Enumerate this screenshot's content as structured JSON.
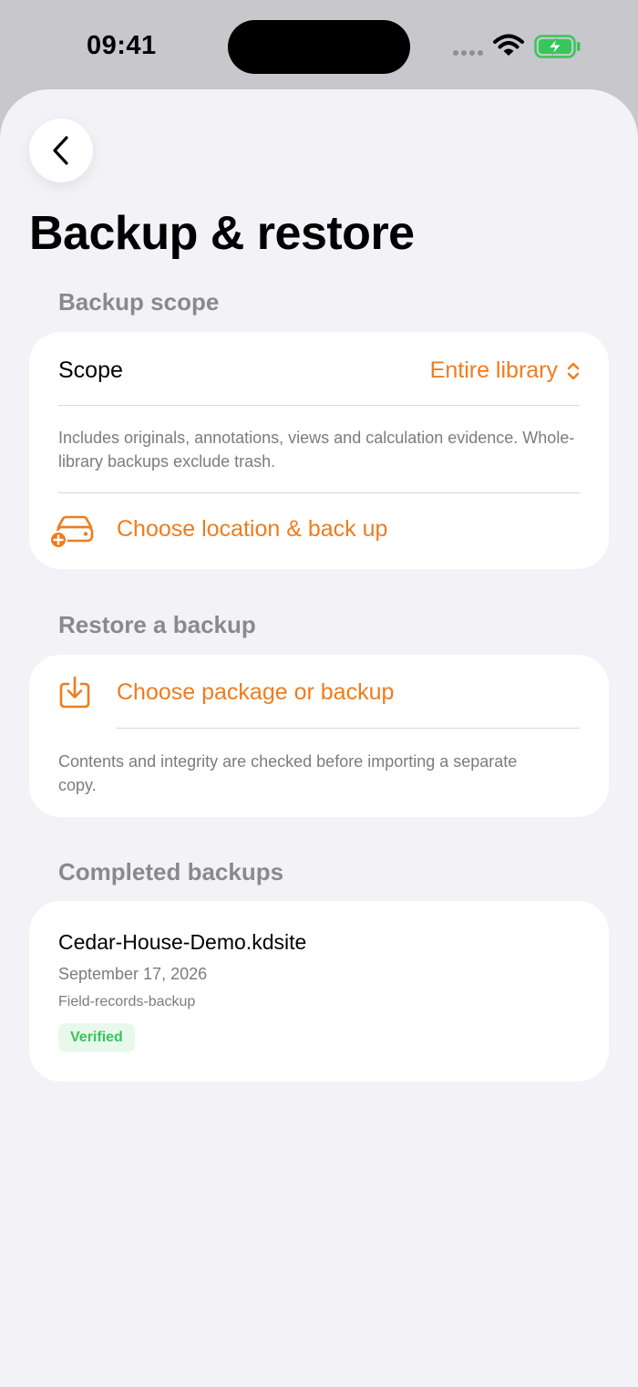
{
  "status_bar": {
    "time": "09:41",
    "icons": [
      "signal-icon",
      "wifi-icon",
      "battery-charging-icon"
    ]
  },
  "header": {
    "back_icon": "chevron-left-icon",
    "title": "Backup & restore"
  },
  "backup_scope": {
    "header": "Backup scope",
    "scope_label": "Scope",
    "scope_value": "Entire library",
    "scope_value_icon": "chevron-up-down-icon",
    "description": "Includes originals, annotations, views and calculation evidence. Whole-library backups exclude trash.",
    "action_icon": "drive-add-icon",
    "action_label": "Choose location & back up"
  },
  "restore": {
    "header": "Restore a backup",
    "action_icon": "import-icon",
    "action_label": "Choose package or backup",
    "description": "Contents and integrity are checked before importing a separate copy."
  },
  "completed": {
    "header": "Completed backups",
    "items": [
      {
        "name": "Cedar-House-Demo.kdsite",
        "date": "September 17, 2026",
        "tag": "Field-records-backup",
        "status": "Verified"
      }
    ]
  },
  "colors": {
    "accent": "#f07c1d",
    "success": "#34c759",
    "background": "#f2f2f7",
    "card": "#ffffff"
  }
}
